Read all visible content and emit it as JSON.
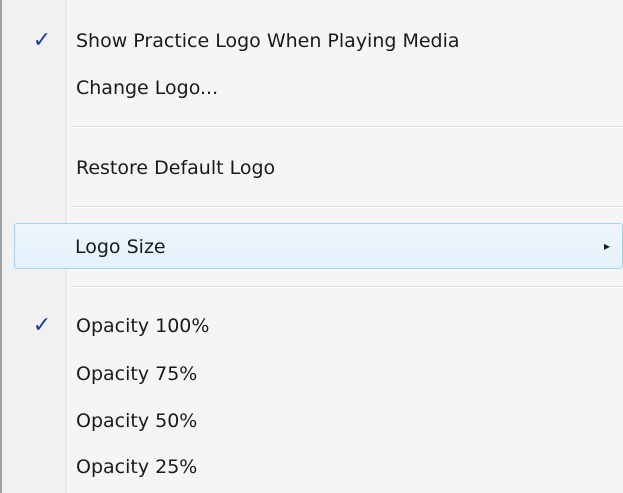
{
  "menu": {
    "items": [
      {
        "label": "Show Practice Logo When Playing Media",
        "checked": true,
        "check_glyph": "✓"
      },
      {
        "label": "Change Logo..."
      },
      {
        "label": "Restore Default Logo"
      },
      {
        "label": "Logo Size",
        "submenu": true,
        "arrow_glyph": "▸",
        "highlighted": true
      },
      {
        "label": "Opacity 100%",
        "checked": true,
        "check_glyph": "✓"
      },
      {
        "label": "Opacity 75%"
      },
      {
        "label": "Opacity 50%"
      },
      {
        "label": "Opacity 25%"
      }
    ]
  },
  "colors": {
    "highlight_border": "#a8d1f0",
    "highlight_fill": "#e4f1fb",
    "check": "#1f3f99",
    "text": "#1a1a1a"
  }
}
